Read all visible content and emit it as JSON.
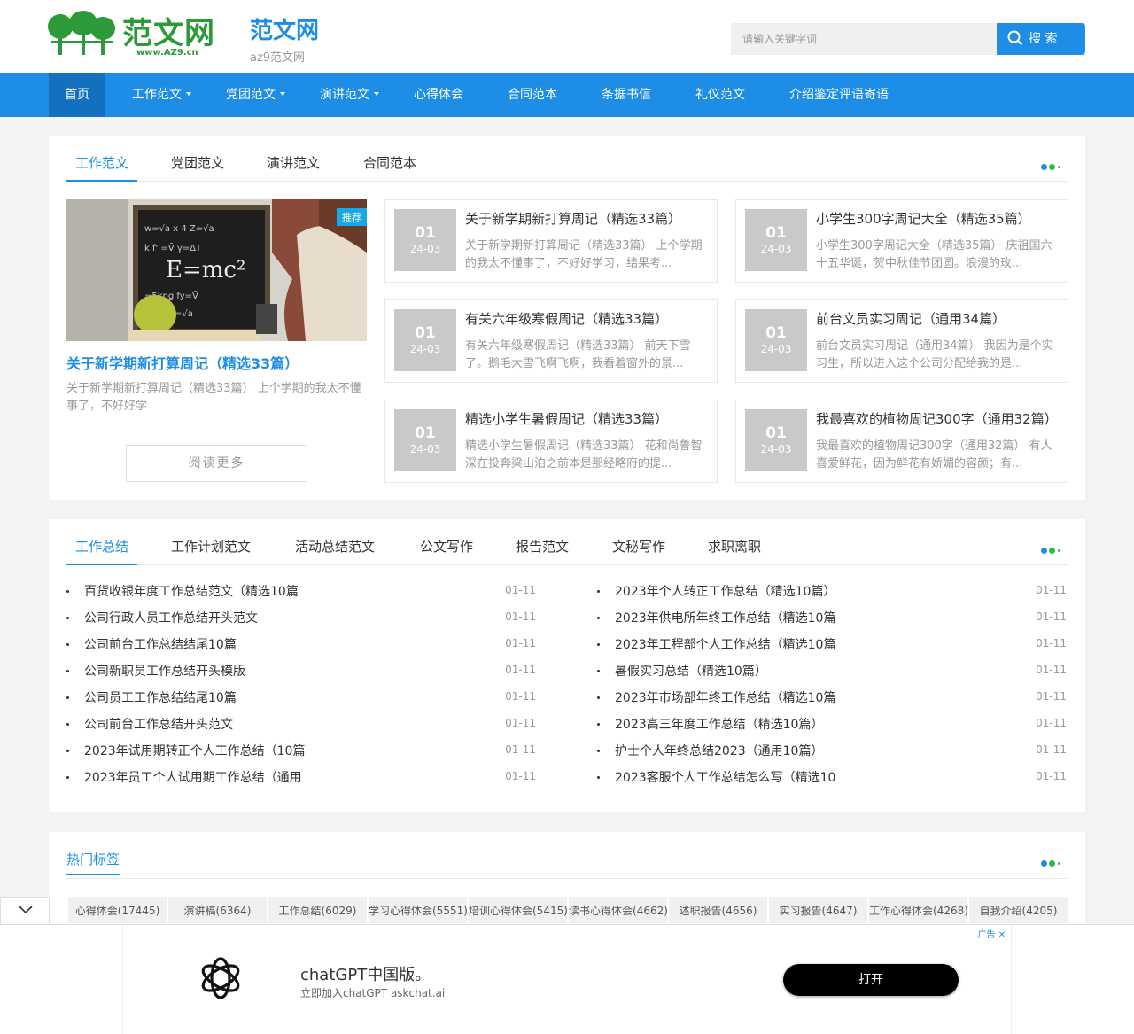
{
  "header": {
    "logo_text": "范文网",
    "logo_url": "www.AZ9.cn",
    "site_name": "范文网",
    "site_sub": "az9范文网",
    "search_placeholder": "请输入关键字词",
    "search_button": "搜 索"
  },
  "nav": {
    "items": [
      {
        "label": "首页",
        "dropdown": false
      },
      {
        "label": "工作范文",
        "dropdown": true
      },
      {
        "label": "党团范文",
        "dropdown": true
      },
      {
        "label": "演讲范文",
        "dropdown": true
      },
      {
        "label": "心得体会",
        "dropdown": false
      },
      {
        "label": "合同范本",
        "dropdown": false
      },
      {
        "label": "条据书信",
        "dropdown": false
      },
      {
        "label": "礼仪范文",
        "dropdown": false
      },
      {
        "label": "介绍鉴定评语寄语",
        "dropdown": false
      }
    ]
  },
  "section1": {
    "tabs": [
      "工作范文",
      "党团范文",
      "演讲范文",
      "合同范本"
    ],
    "feature": {
      "badge": "推荐",
      "title": "关于新学期新打算周记（精选33篇）",
      "desc": "关于新学期新打算周记（精选33篇） 上个学期的我太不懂事了，不好好学",
      "read_more": "阅读更多"
    },
    "cards": [
      {
        "day": "01",
        "ym": "24-03",
        "title": "关于新学期新打算周记（精选33篇）",
        "desc": "关于新学期新打算周记（精选33篇） 上个学期的我太不懂事了，不好好学习，结果考..."
      },
      {
        "day": "01",
        "ym": "24-03",
        "title": "小学生300字周记大全（精选35篇）",
        "desc": "小学生300字周记大全（精选35篇） 庆祖国六十五华诞，贺中秋佳节团圆。浪漫的玫..."
      },
      {
        "day": "01",
        "ym": "24-03",
        "title": "有关六年级寒假周记（精选33篇）",
        "desc": "有关六年级寒假周记（精选33篇） 前天下雪了。鹅毛大雪飞啊飞啊，我看着窗外的景..."
      },
      {
        "day": "01",
        "ym": "24-03",
        "title": "前台文员实习周记（通用34篇）",
        "desc": "前台文员实习周记（通用34篇） 我因为是个实习生，所以进入这个公司分配给我的是..."
      },
      {
        "day": "01",
        "ym": "24-03",
        "title": "精选小学生暑假周记（精选33篇）",
        "desc": "精选小学生暑假周记（精选33篇） 花和尚鲁智深在投奔梁山泊之前本是那经略府的提..."
      },
      {
        "day": "01",
        "ym": "24-03",
        "title": "我最喜欢的植物周记300字（通用32篇）",
        "desc": "我最喜欢的植物周记300字（通用32篇） 有人喜爱鲜花，因为鲜花有娇媚的容颜；有..."
      }
    ]
  },
  "section2": {
    "tabs": [
      "工作总结",
      "工作计划范文",
      "活动总结范文",
      "公文写作",
      "报告范文",
      "文秘写作",
      "求职离职"
    ],
    "left": [
      {
        "text": "百货收银年度工作总结范文（精选10篇",
        "date": "01-11"
      },
      {
        "text": "公司行政人员工作总结开头范文",
        "date": "01-11"
      },
      {
        "text": "公司前台工作总结结尾10篇",
        "date": "01-11"
      },
      {
        "text": "公司新职员工作总结开头模版",
        "date": "01-11"
      },
      {
        "text": "公司员工工作总结结尾10篇",
        "date": "01-11"
      },
      {
        "text": "公司前台工作总结开头范文",
        "date": "01-11"
      },
      {
        "text": "2023年试用期转正个人工作总结（10篇",
        "date": "01-11"
      },
      {
        "text": "2023年员工个人试用期工作总结（通用",
        "date": "01-11"
      }
    ],
    "right": [
      {
        "text": "2023年个人转正工作总结（精选10篇）",
        "date": "01-11"
      },
      {
        "text": "2023年供电所年终工作总结（精选10篇",
        "date": "01-11"
      },
      {
        "text": "2023年工程部个人工作总结（精选10篇",
        "date": "01-11"
      },
      {
        "text": "暑假实习总结（精选10篇）",
        "date": "01-11"
      },
      {
        "text": "2023年市场部年终工作总结（精选10篇",
        "date": "01-11"
      },
      {
        "text": "2023高三年度工作总结（精选10篇）",
        "date": "01-11"
      },
      {
        "text": "护士个人年终总结2023（通用10篇）",
        "date": "01-11"
      },
      {
        "text": "2023客服个人工作总结怎么写（精选10",
        "date": "01-11"
      }
    ]
  },
  "tags": {
    "title": "热门标签",
    "items": [
      "心得体会(17445)",
      "演讲稿(6364)",
      "工作总结(6029)",
      "学习心得体会(5551)",
      "培训心得体会(5415)",
      "读书心得体会(4662)",
      "述职报告(4656)",
      "实习报告(4647)",
      "工作心得体会(4268)",
      "自我介绍(4205)"
    ]
  },
  "ad": {
    "label": "广告 ✕",
    "title": "chatGPT中国版。",
    "sub": "立即加入chatGPT askchat.ai",
    "button": "打开"
  },
  "colors": {
    "accent": "#1d8de6",
    "nav_active": "#1370bf",
    "logo_green": "#2d9a3a"
  }
}
